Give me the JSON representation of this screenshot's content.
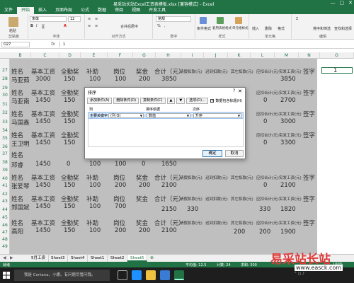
{
  "window": {
    "title": "易采站长站Excel工资表模板.xlsx [兼容模式] - Excel",
    "controls": [
      "—",
      "▢",
      "✕"
    ]
  },
  "ribbon": {
    "tabs": [
      "文件",
      "开始",
      "插入",
      "页面布局",
      "公式",
      "数据",
      "审阅",
      "视图",
      "开发工具"
    ],
    "active_tab": "开始",
    "font_name": "宋体",
    "font_size": "12",
    "number_format": "常规",
    "groups": [
      "剪贴板",
      "字体",
      "对齐方式",
      "数字",
      "样式",
      "单元格",
      "编辑"
    ],
    "buttons": {
      "paste": "粘贴",
      "cond_format": "条件格式",
      "table_format": "套用表格格式",
      "cell_style": "单元格样式",
      "insert": "插入",
      "delete": "删除",
      "format": "格式",
      "sort": "排序和筛选",
      "find": "查找和选择",
      "merge": "合并后居中"
    }
  },
  "formula_bar": {
    "name_box": "O27",
    "fx": "fx",
    "value": "1"
  },
  "grid": {
    "columns": [
      "B",
      "C",
      "D",
      "E",
      "F",
      "G",
      "H",
      "I",
      "J",
      "K",
      "L",
      "M",
      "N",
      "O"
    ],
    "rows": [
      "27",
      "28",
      "29",
      "30",
      "31",
      "32",
      "33",
      "34",
      "35",
      "36",
      "37",
      "38",
      "39",
      "40",
      "41",
      "42",
      "43",
      "44",
      "45",
      "46",
      "47",
      "48",
      "49",
      "50",
      "51",
      "52"
    ],
    "header_labels": [
      "姓名",
      "基本工资",
      "全勤奖",
      "补助",
      "岗位",
      "奖金",
      "合计（元）",
      "请假扣款(元)",
      "迟到扣款(元)",
      "其它扣款(元)",
      "应扣合计(元)",
      "实发工资(元)",
      "签字"
    ],
    "records": [
      {
        "name": "马亚茹",
        "base": "3000",
        "attend": "150",
        "subsidy": "100",
        "post": "100",
        "bonus": "200",
        "total": "3850",
        "leave": "",
        "late": "",
        "other": "",
        "deduct": "",
        "net": "3850"
      },
      {
        "name": "马亚南",
        "base": "1450",
        "attend": "150",
        "subsidy": "",
        "post": "",
        "bonus": "",
        "total": "",
        "leave": "",
        "late": "",
        "other": "",
        "deduct": "0",
        "net": "2700"
      },
      {
        "name": "马国鑫",
        "base": "1450",
        "attend": "150",
        "subsidy": "",
        "post": "",
        "bonus": "",
        "total": "",
        "leave": "",
        "late": "",
        "other": "",
        "deduct": "0",
        "net": "3000"
      },
      {
        "name": "王卫明",
        "base": "1450",
        "attend": "150",
        "subsidy": "",
        "post": "",
        "bonus": "",
        "total": "",
        "leave": "",
        "late": "",
        "other": "",
        "deduct": "0",
        "net": "3300"
      },
      {
        "name": "邓睿",
        "base": "1450",
        "attend": "0",
        "subsidy": "100",
        "post": "100",
        "bonus": "0",
        "total": "1650",
        "leave": "",
        "late": "",
        "other": "",
        "deduct": "",
        "net": ""
      },
      {
        "name": "张爱琴",
        "base": "1450",
        "attend": "150",
        "subsidy": "100",
        "post": "200",
        "bonus": "200",
        "total": "2100",
        "leave": "",
        "late": "",
        "other": "",
        "deduct": "0",
        "net": "2100"
      },
      {
        "name": "郑国斌",
        "base": "1450",
        "attend": "150",
        "subsidy": "100",
        "post": "700",
        "bonus": "",
        "total": "2150",
        "leave": "330",
        "late": "",
        "other": "",
        "deduct": "330",
        "net": "1820"
      },
      {
        "name": "高阳",
        "base": "1450",
        "attend": "150",
        "subsidy": "100",
        "post": "200",
        "bonus": "200",
        "total": "2100",
        "leave": "",
        "late": "",
        "other": "200",
        "deduct": "200",
        "net": "1900"
      }
    ],
    "selected_value": "1"
  },
  "sort_dialog": {
    "title": "排序",
    "help": "?",
    "close": "✕",
    "toolbar": {
      "add": "添加条件(A)",
      "delete": "删除条件(D)",
      "copy": "复制条件(C)",
      "up": "▲",
      "down": "▼",
      "options": "选项(O)..."
    },
    "has_header_label": "数据包含标题(H)",
    "has_header_checked": "✓",
    "col_header": "列",
    "sort_on_header": "排序依据",
    "order_header": "次序",
    "row_label": "主要关键字",
    "key_value": "(列 O)",
    "sort_on_value": "数值",
    "order_value": "升序",
    "ok": "确定",
    "cancel": "取消"
  },
  "sheets": {
    "nav": [
      "◀",
      "▶"
    ],
    "tabs": [
      "5月工资",
      "Sheet3",
      "Sheet4",
      "Sheet1",
      "Sheet2",
      "Sheet5"
    ],
    "active": "Sheet5",
    "add": "⊕"
  },
  "status": {
    "ready": "就绪",
    "average": "平均值: 12.5",
    "count": "计数: 24",
    "sum": "求和: 300",
    "zoom": "100%"
  },
  "taskbar": {
    "search": "我是 Cortana，小娜。有问题尽管问我。"
  },
  "watermark": {
    "brand": "易采站长站",
    "url": "www.easck.com"
  }
}
